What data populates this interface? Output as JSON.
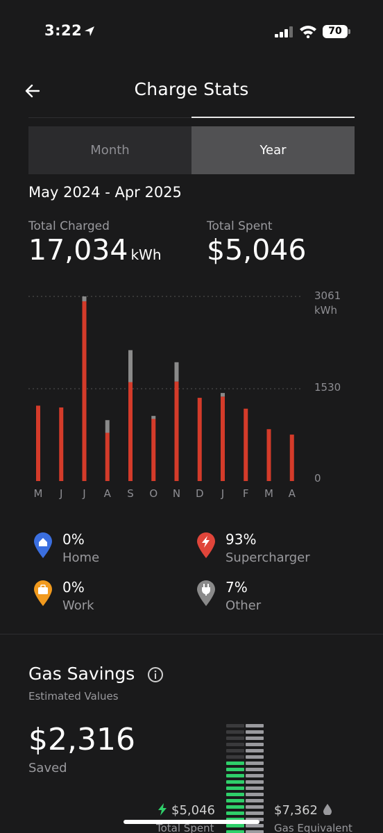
{
  "status_bar": {
    "time": "3:22",
    "battery": "70"
  },
  "header": {
    "title": "Charge Stats",
    "back_icon": "arrow-left-icon"
  },
  "tabs": [
    {
      "label": "Month",
      "active": false
    },
    {
      "label": "Year",
      "active": true
    }
  ],
  "date_range": "May 2024 - Apr 2025",
  "stats": {
    "total_charged_label": "Total Charged",
    "total_charged_value": "17,034",
    "total_charged_unit": "kWh",
    "total_spent_label": "Total Spent",
    "total_spent_value": "$5,046"
  },
  "chart_data": {
    "type": "bar",
    "stacked": true,
    "categories": [
      "M",
      "J",
      "J",
      "A",
      "S",
      "O",
      "N",
      "D",
      "J",
      "F",
      "M",
      "A"
    ],
    "series": [
      {
        "color": "#d43b2a",
        "values": [
          1250,
          1220,
          2980,
          800,
          1640,
          1030,
          1650,
          1380,
          1400,
          1200,
          860,
          770
        ]
      },
      {
        "color": "#8a8a8a",
        "values": [
          0,
          0,
          81,
          210,
          530,
          50,
          320,
          0,
          60,
          0,
          0,
          0
        ]
      }
    ],
    "y_ticks": [
      "3061",
      "1530",
      "0"
    ],
    "y_unit": "kWh",
    "ylim": [
      0,
      3061
    ],
    "grid": true
  },
  "breakdown": [
    {
      "pct": "0%",
      "label": "Home",
      "color": "#3b6fe0",
      "icon": "home-icon"
    },
    {
      "pct": "93%",
      "label": "Supercharger",
      "color": "#e0453a",
      "icon": "lightning-icon"
    },
    {
      "pct": "0%",
      "label": "Work",
      "color": "#f19a1e",
      "icon": "briefcase-icon"
    },
    {
      "pct": "7%",
      "label": "Other",
      "color": "#8a8a8a",
      "icon": "plug-icon"
    }
  ],
  "gas_savings": {
    "title": "Gas Savings",
    "subtitle": "Estimated Values",
    "saved_value": "$2,316",
    "saved_label": "Saved",
    "spent_value": "$5,046",
    "spent_label": "Total Spent",
    "gas_value": "$7,362",
    "gas_label": "Gas Equivalent",
    "electric_fraction": 0.69
  }
}
